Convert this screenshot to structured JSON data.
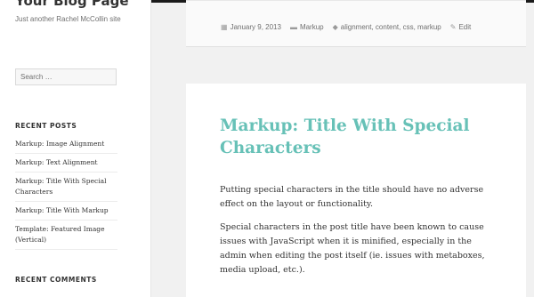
{
  "site": {
    "title": "Your Blog Page",
    "description": "Just another Rachel McCollin site"
  },
  "search": {
    "placeholder": "Search …"
  },
  "widgets": {
    "recent_posts_title": "RECENT POSTS",
    "recent_posts": [
      "Markup: Image Alignment",
      "Markup: Text Alignment",
      "Markup: Title With Special Characters",
      "Markup: Title With Markup",
      "Template: Featured Image (Vertical)"
    ],
    "recent_comments_title": "RECENT COMMENTS"
  },
  "meta": {
    "date": "January 9, 2013",
    "category": "Markup",
    "tags": "alignment, content, css, markup",
    "edit": "Edit",
    "icons": {
      "date": "calendar-icon",
      "category": "folder-icon",
      "tags": "tag-icon",
      "edit": "pencil-icon"
    }
  },
  "article": {
    "title": "Markup: Title With Special Characters",
    "paragraphs": [
      "Putting special characters in the title should have no adverse effect on the layout or functionality.",
      "Special characters in the post title have been known to cause issues with JavaScript when it is minified, especially in the admin when editing the post itself (ie. issues with metaboxes, media upload, etc.)."
    ]
  },
  "colors": {
    "accent": "#67c1b7",
    "text": "#333333",
    "meta": "#707070"
  }
}
